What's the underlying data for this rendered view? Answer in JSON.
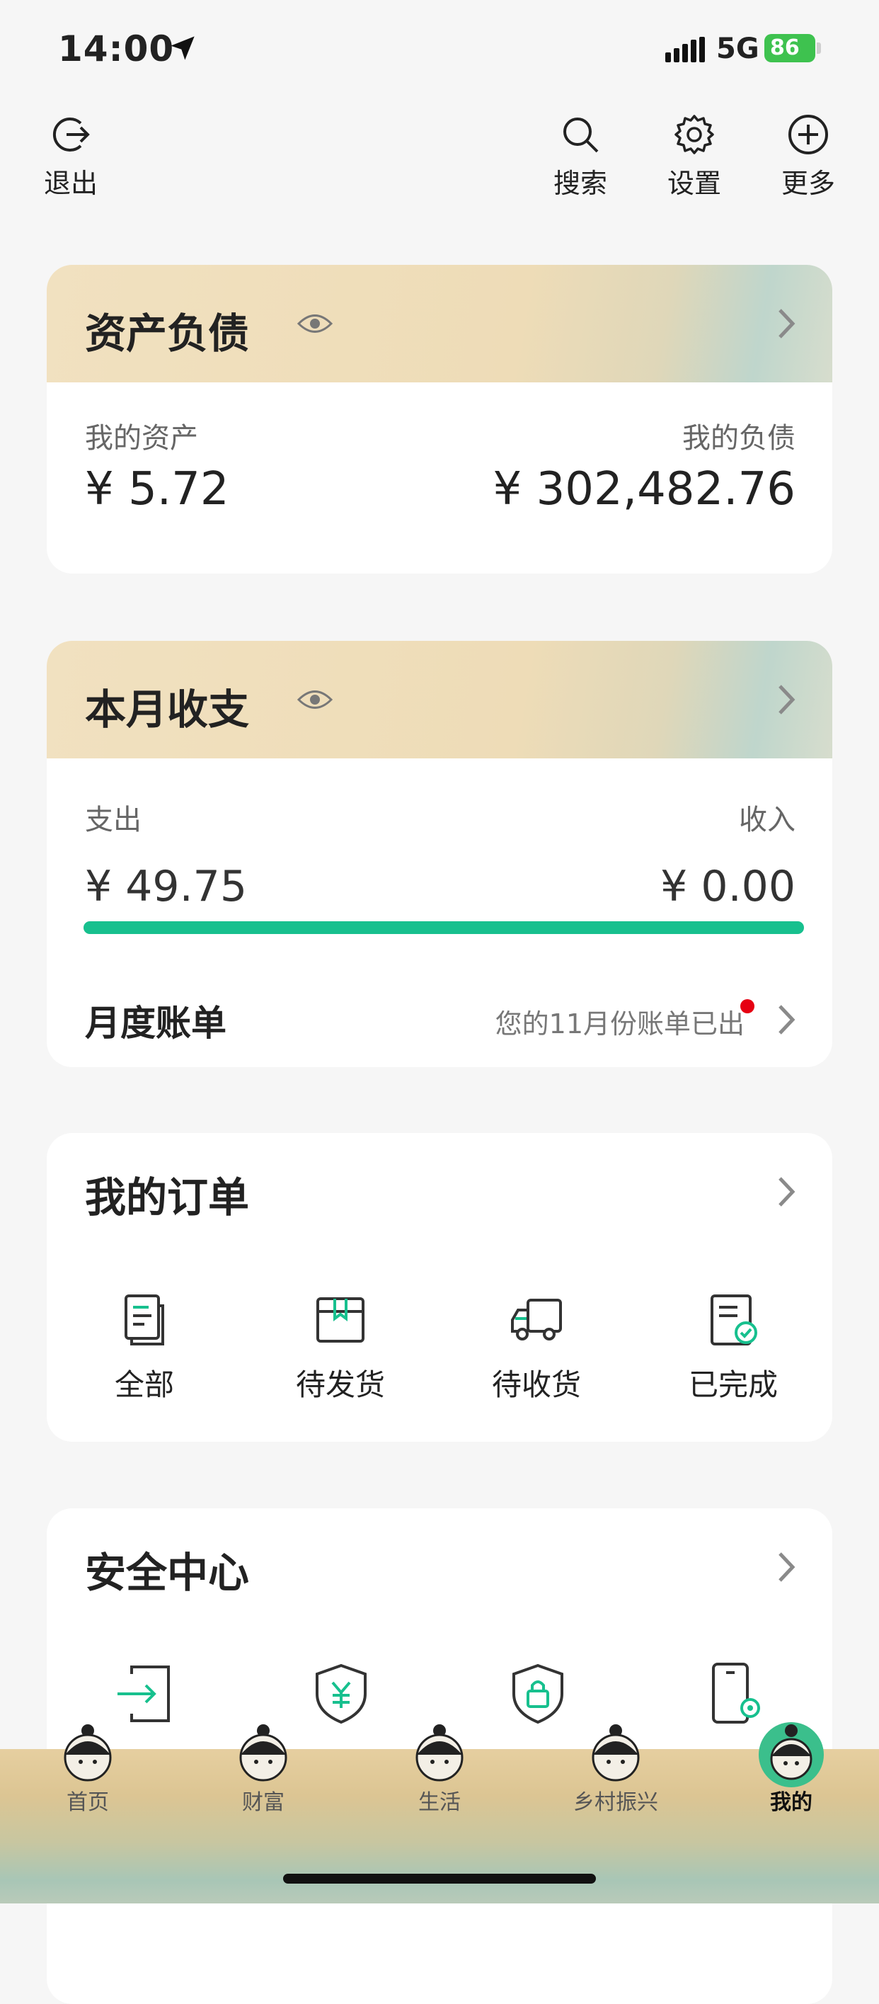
{
  "status": {
    "time": "14:00",
    "network": "5G",
    "battery": "86"
  },
  "topnav": {
    "exit": "退出",
    "search": "搜索",
    "settings": "设置",
    "more": "更多"
  },
  "assets": {
    "title": "资产负债",
    "my_assets_label": "我的资产",
    "my_assets_value": "¥ 5.72",
    "my_debt_label": "我的负债",
    "my_debt_value": "¥ 302,482.76"
  },
  "monthly": {
    "title": "本月收支",
    "expense_label": "支出",
    "income_label": "收入",
    "expense_value": "¥ 49.75",
    "income_value": "¥ 0.00",
    "expense_share": 1.0,
    "bill_label": "月度账单",
    "bill_note": "您的11月份账单已出"
  },
  "orders": {
    "title": "我的订单",
    "items": [
      {
        "label": "全部"
      },
      {
        "label": "待发货"
      },
      {
        "label": "待收货"
      },
      {
        "label": "已完成"
      }
    ]
  },
  "security": {
    "title": "安全中心",
    "items": [
      {
        "label": "登录设置"
      },
      {
        "label": "转账设置"
      },
      {
        "label": "支付设置"
      },
      {
        "label": "手机号管理"
      }
    ]
  },
  "tabs": [
    {
      "label": "首页"
    },
    {
      "label": "财富"
    },
    {
      "label": "生活"
    },
    {
      "label": "乡村振兴"
    },
    {
      "label": "我的"
    }
  ],
  "colors": {
    "accent": "#17c08e",
    "dot": "#e60012"
  }
}
